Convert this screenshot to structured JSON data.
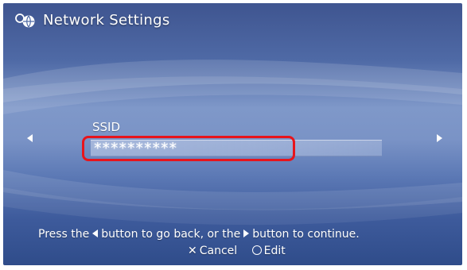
{
  "header": {
    "title": "Network Settings",
    "icon": "globe-network-icon"
  },
  "nav": {
    "left_icon": "left-arrow-icon",
    "right_icon": "right-arrow-icon"
  },
  "ssid": {
    "label": "SSID",
    "value": "**********"
  },
  "footer": {
    "instruction_part1": "Press the",
    "instruction_part2": "button to go back, or the",
    "instruction_part3": "button to continue.",
    "cancel_label": "Cancel",
    "edit_label": "Edit"
  },
  "colors": {
    "highlight": "#e8141b",
    "background_top": "#3f5590",
    "background_mid": "#7f98c9",
    "background_bottom": "#2f4c8a"
  }
}
